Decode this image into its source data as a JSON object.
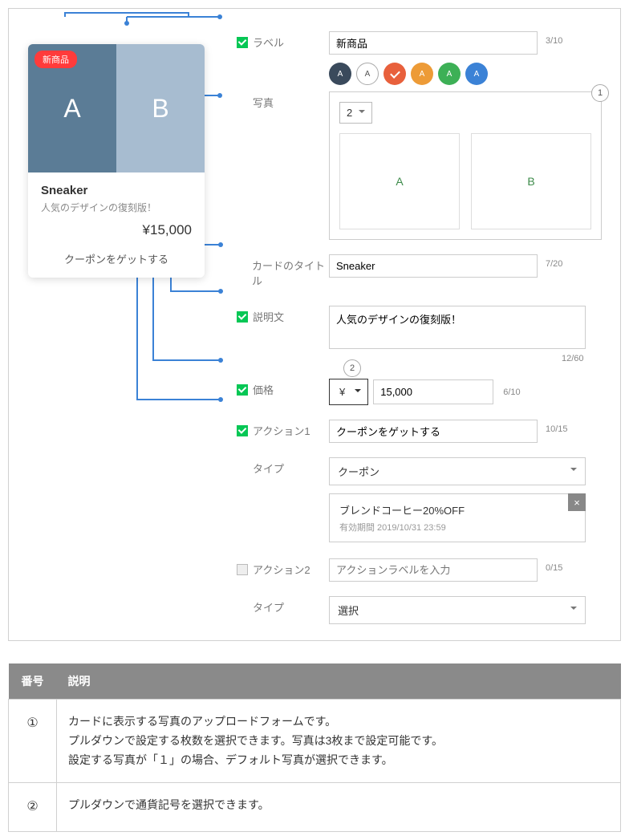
{
  "preview": {
    "badge": "新商品",
    "img_a": "A",
    "img_b": "B",
    "title": "Sneaker",
    "desc": "人気のデザインの復刻版！",
    "price": "¥15,000",
    "action": "クーポンをゲットする"
  },
  "form": {
    "label": {
      "name": "ラベル",
      "value": "新商品",
      "count": "3/10"
    },
    "photo": {
      "name": "写真",
      "tag": "1",
      "select_value": "2",
      "thumb_a": "A",
      "thumb_b": "B"
    },
    "card_title": {
      "name": "カードのタイトル",
      "value": "Sneaker",
      "count": "7/20"
    },
    "desc": {
      "name": "説明文",
      "value": "人気のデザインの復刻版！",
      "count": "12/60"
    },
    "price": {
      "name": "価格",
      "tag": "2",
      "currency": "¥",
      "value": "15,000",
      "count": "6/10"
    },
    "action1": {
      "name": "アクション1",
      "value": "クーポンをゲットする",
      "count": "10/15"
    },
    "type1": {
      "name": "タイプ",
      "value": "クーポン"
    },
    "coupon": {
      "title": "ブレンドコーヒー20%OFF",
      "expire": "有効期間 2019/10/31 23:59"
    },
    "action2": {
      "name": "アクション2",
      "placeholder": "アクションラベルを入力",
      "count": "0/15"
    },
    "type2": {
      "name": "タイプ",
      "value": "選択"
    },
    "swatch_letter": "A"
  },
  "table": {
    "head_num": "番号",
    "head_desc": "説明",
    "rows": [
      {
        "num": "①",
        "desc": "カードに表示する写真のアップロードフォームです。\nプルダウンで設定する枚数を選択できます。写真は3枚まで設定可能です。\n設定する写真が「１」の場合、デフォルト写真が選択できます。"
      },
      {
        "num": "②",
        "desc": "プルダウンで通貨記号を選択できます。"
      }
    ]
  }
}
